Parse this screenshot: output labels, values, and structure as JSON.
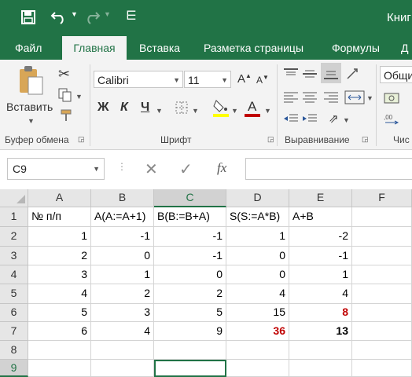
{
  "app": {
    "title": "Книг"
  },
  "tabs": [
    "Файл",
    "Главная",
    "Вставка",
    "Разметка страницы",
    "Формулы",
    "Д"
  ],
  "ribbon": {
    "paste_label": "Вставить",
    "font_name": "Calibri",
    "font_size": "11",
    "bold": "Ж",
    "italic": "К",
    "underline": "Ч",
    "wrap_text_partial": "Общи",
    "groups": [
      "Буфер обмена",
      "Шрифт",
      "Выравнивание",
      "Чис"
    ]
  },
  "formula_bar": {
    "name_box": "C9",
    "fx": "fx",
    "formula": ""
  },
  "columns": [
    "A",
    "B",
    "C",
    "D",
    "E",
    "F"
  ],
  "rows": [
    "1",
    "2",
    "3",
    "4",
    "5",
    "6",
    "7",
    "8",
    "9"
  ],
  "cells": {
    "r1": [
      "№ п/п",
      "A(A:=A+1)",
      "B(B:=B+A)",
      "S(S:=A*B)",
      "A+B",
      ""
    ],
    "r2": [
      "1",
      "-1",
      "-1",
      "1",
      "-2",
      ""
    ],
    "r3": [
      "2",
      "0",
      "-1",
      "0",
      "-1",
      ""
    ],
    "r4": [
      "3",
      "1",
      "0",
      "0",
      "1",
      ""
    ],
    "r5": [
      "4",
      "2",
      "2",
      "4",
      "4",
      ""
    ],
    "r6": [
      "5",
      "3",
      "5",
      "15",
      "8",
      ""
    ],
    "r7": [
      "6",
      "4",
      "9",
      "36",
      "13",
      ""
    ]
  },
  "colors": {
    "brand": "#217346",
    "highlight_red": "#c00000",
    "highlight_yellow": "#ffff00",
    "font_red": "#c00000"
  },
  "active_cell": "C9"
}
